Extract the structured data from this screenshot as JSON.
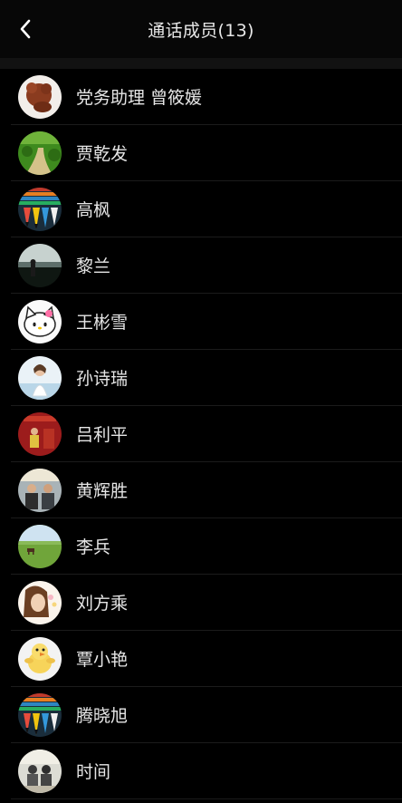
{
  "header": {
    "title": "通话成员(13)"
  },
  "members": [
    {
      "name": "党务助理 曾筱媛",
      "avatar": "avatar-dog"
    },
    {
      "name": "贾乾发",
      "avatar": "avatar-path"
    },
    {
      "name": "高枫",
      "avatar": "avatar-pencils"
    },
    {
      "name": "黎兰",
      "avatar": "avatar-sea"
    },
    {
      "name": "王彬雪",
      "avatar": "avatar-kitty"
    },
    {
      "name": "孙诗瑞",
      "avatar": "avatar-girl"
    },
    {
      "name": "吕利平",
      "avatar": "avatar-red"
    },
    {
      "name": "黄辉胜",
      "avatar": "avatar-group"
    },
    {
      "name": "李兵",
      "avatar": "avatar-grassland"
    },
    {
      "name": "刘方乘",
      "avatar": "avatar-woman"
    },
    {
      "name": "覃小艳",
      "avatar": "avatar-chick"
    },
    {
      "name": "腾晓旭",
      "avatar": "avatar-pencils"
    },
    {
      "name": "时间",
      "avatar": "avatar-couple"
    }
  ]
}
